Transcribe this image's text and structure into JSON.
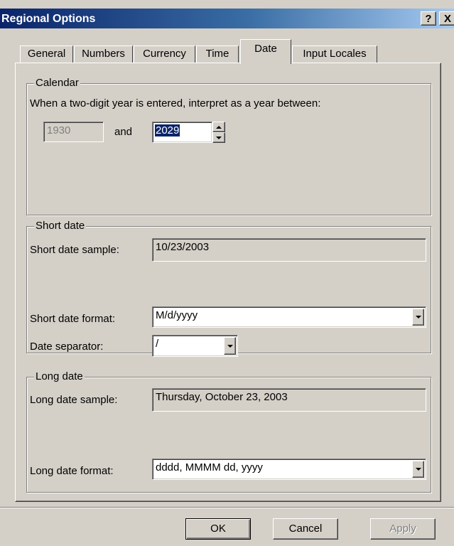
{
  "window": {
    "title": "Regional Options",
    "help_label": "?",
    "close_label": "X"
  },
  "tabs": [
    {
      "label": "General"
    },
    {
      "label": "Numbers"
    },
    {
      "label": "Currency"
    },
    {
      "label": "Time"
    },
    {
      "label": "Date",
      "active": true
    },
    {
      "label": "Input Locales"
    }
  ],
  "calendar": {
    "legend": "Calendar",
    "description": "When a two-digit year is entered, interpret as a year between:",
    "start_year": "1930",
    "and_label": "and",
    "end_year": "2029"
  },
  "short_date": {
    "legend": "Short date",
    "sample_label": "Short date sample:",
    "sample_value": "10/23/2003",
    "format_label": "Short date format:",
    "format_value": "M/d/yyyy",
    "separator_label": "Date separator:",
    "separator_value": "/"
  },
  "long_date": {
    "legend": "Long date",
    "sample_label": "Long date sample:",
    "sample_value": "Thursday, October 23, 2003",
    "format_label": "Long date format:",
    "format_value": "dddd, MMMM dd, yyyy"
  },
  "buttons": {
    "ok": "OK",
    "cancel": "Cancel",
    "apply": "Apply"
  },
  "colors": {
    "title_bar": "#0a246a",
    "face": "#d4d0c8",
    "selection": "#0a246a"
  }
}
